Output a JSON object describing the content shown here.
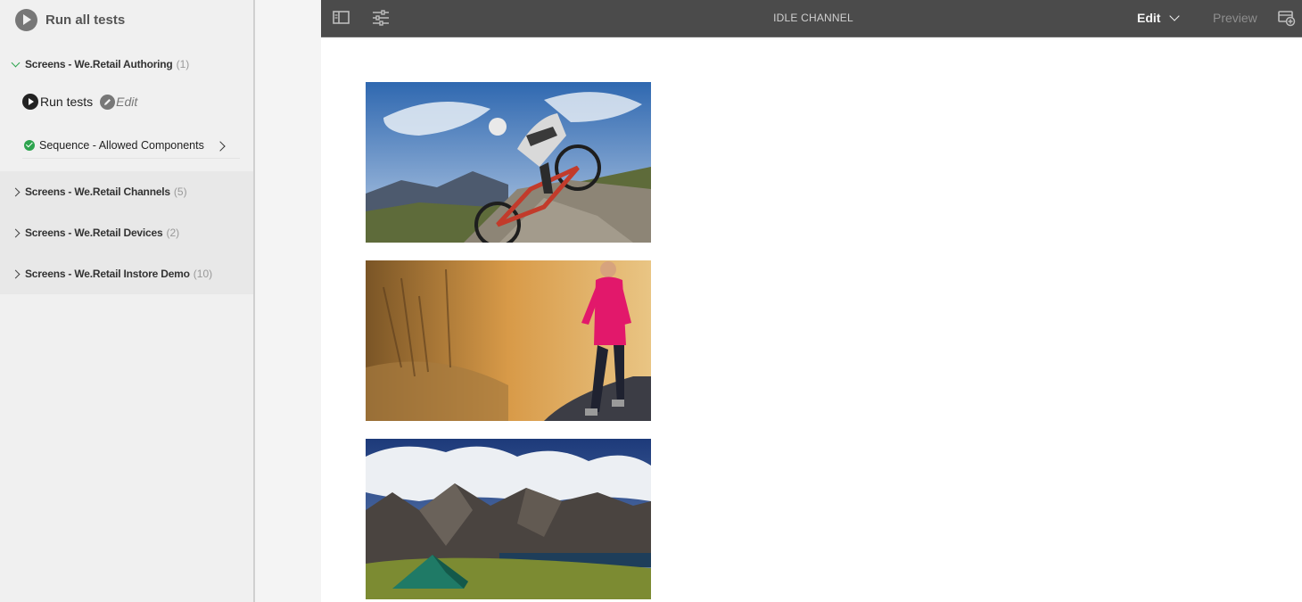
{
  "test_panel": {
    "run_all_label": "Run all tests",
    "groups": [
      {
        "title": "Screens - We.Retail Authoring",
        "count": "(1)",
        "expanded": true,
        "actions": {
          "run_label": "Run tests",
          "edit_label": "Edit"
        },
        "tests": [
          {
            "name": "Sequence - Allowed Components",
            "status": "passed"
          }
        ]
      },
      {
        "title": "Screens - We.Retail Channels",
        "count": "(5)",
        "expanded": false
      },
      {
        "title": "Screens - We.Retail Devices",
        "count": "(2)",
        "expanded": false
      },
      {
        "title": "Screens - We.Retail Instore Demo",
        "count": "(10)",
        "expanded": false
      }
    ]
  },
  "toolbar": {
    "title": "IDLE CHANNEL",
    "mode_label": "Edit",
    "preview_label": "Preview",
    "icons": [
      "toggle-side-panel-icon",
      "page-properties-icon",
      "emulator-icon"
    ]
  },
  "content": {
    "images": [
      {
        "subject": "mountain-biker"
      },
      {
        "subject": "woman-jogging"
      },
      {
        "subject": "tent-in-mountains"
      }
    ]
  },
  "colors": {
    "toolbar_bg": "#4b4b4b",
    "panel_bg": "#f0f0f0",
    "success": "#2da44e"
  }
}
